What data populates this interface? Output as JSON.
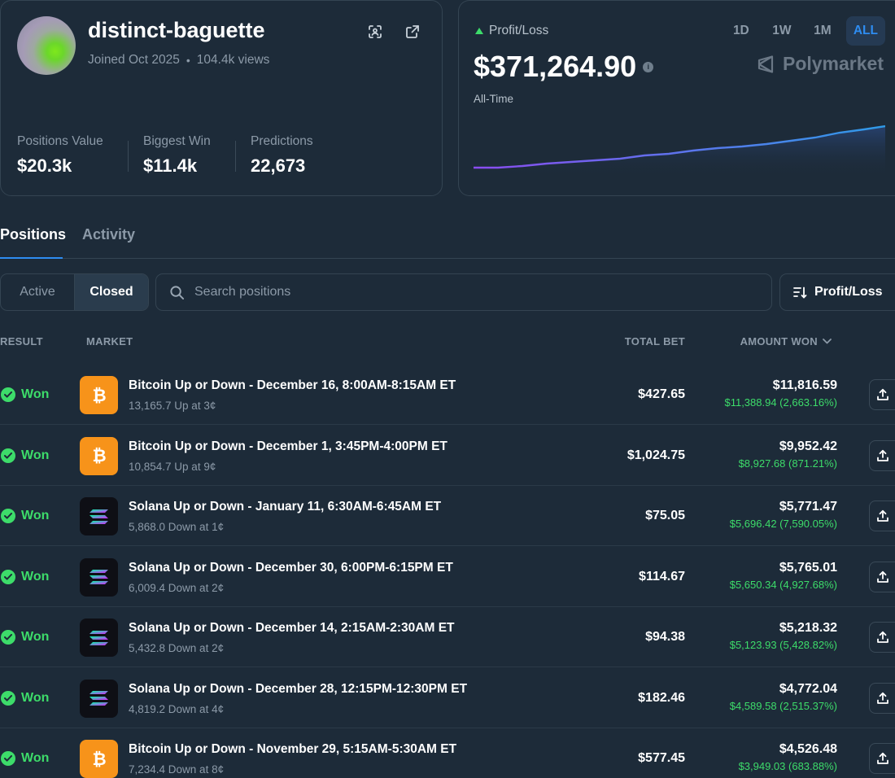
{
  "profile": {
    "username": "distinct-baguette",
    "joined": "Joined Oct 2025",
    "separator": "•",
    "views": "104.4k views",
    "stats": [
      {
        "label": "Positions Value",
        "value": "$20.3k"
      },
      {
        "label": "Biggest Win",
        "value": "$11.4k"
      },
      {
        "label": "Predictions",
        "value": "22,673"
      }
    ],
    "icons": [
      "scan-icon",
      "external-link-icon"
    ]
  },
  "pnl": {
    "label": "Profit/Loss",
    "value": "$371,264.90",
    "info_glyph": "i",
    "period": "All-Time",
    "timeframes": [
      "1D",
      "1W",
      "1M",
      "ALL"
    ],
    "active_timeframe": "ALL",
    "brand": "Polymarket",
    "trend_color": "#3ddc6a"
  },
  "tabs": {
    "positions": "Positions",
    "activity": "Activity"
  },
  "filters": {
    "active": "Active",
    "closed": "Closed",
    "search_placeholder": "Search positions",
    "sort_label": "Profit/Loss"
  },
  "table": {
    "headers": {
      "result": "RESULT",
      "market": "MARKET",
      "total_bet": "TOTAL BET",
      "amount_won": "AMOUNT WON"
    },
    "rows": [
      {
        "result": "Won",
        "asset": "btc",
        "title": "Bitcoin Up or Down - December 16, 8:00AM-8:15AM ET",
        "sub": "13,165.7 Up at 3¢",
        "total_bet": "$427.65",
        "amount_won": "$11,816.59",
        "gain": "$11,388.94 (2,663.16%)"
      },
      {
        "result": "Won",
        "asset": "btc",
        "title": "Bitcoin Up or Down - December 1, 3:45PM-4:00PM ET",
        "sub": "10,854.7 Up at 9¢",
        "total_bet": "$1,024.75",
        "amount_won": "$9,952.42",
        "gain": "$8,927.68 (871.21%)"
      },
      {
        "result": "Won",
        "asset": "sol",
        "title": "Solana Up or Down - January 11, 6:30AM-6:45AM ET",
        "sub": "5,868.0 Down at 1¢",
        "total_bet": "$75.05",
        "amount_won": "$5,771.47",
        "gain": "$5,696.42 (7,590.05%)"
      },
      {
        "result": "Won",
        "asset": "sol",
        "title": "Solana Up or Down - December 30, 6:00PM-6:15PM ET",
        "sub": "6,009.4 Down at 2¢",
        "total_bet": "$114.67",
        "amount_won": "$5,765.01",
        "gain": "$5,650.34 (4,927.68%)"
      },
      {
        "result": "Won",
        "asset": "sol",
        "title": "Solana Up or Down - December 14, 2:15AM-2:30AM ET",
        "sub": "5,432.8 Down at 2¢",
        "total_bet": "$94.38",
        "amount_won": "$5,218.32",
        "gain": "$5,123.93 (5,428.82%)"
      },
      {
        "result": "Won",
        "asset": "sol",
        "title": "Solana Up or Down - December 28, 12:15PM-12:30PM ET",
        "sub": "4,819.2 Down at 4¢",
        "total_bet": "$182.46",
        "amount_won": "$4,772.04",
        "gain": "$4,589.58 (2,515.37%)"
      },
      {
        "result": "Won",
        "asset": "btc",
        "title": "Bitcoin Up or Down - November 29, 5:15AM-5:30AM ET",
        "sub": "7,234.4 Down at 8¢",
        "total_bet": "$577.45",
        "amount_won": "$4,526.48",
        "gain": "$3,949.03 (683.88%)"
      }
    ]
  },
  "colors": {
    "background": "#1d2b39",
    "accent": "#2e8cf0",
    "success": "#3ddc6a",
    "muted": "#8c9aa8",
    "bitcoin": "#f7931a"
  }
}
